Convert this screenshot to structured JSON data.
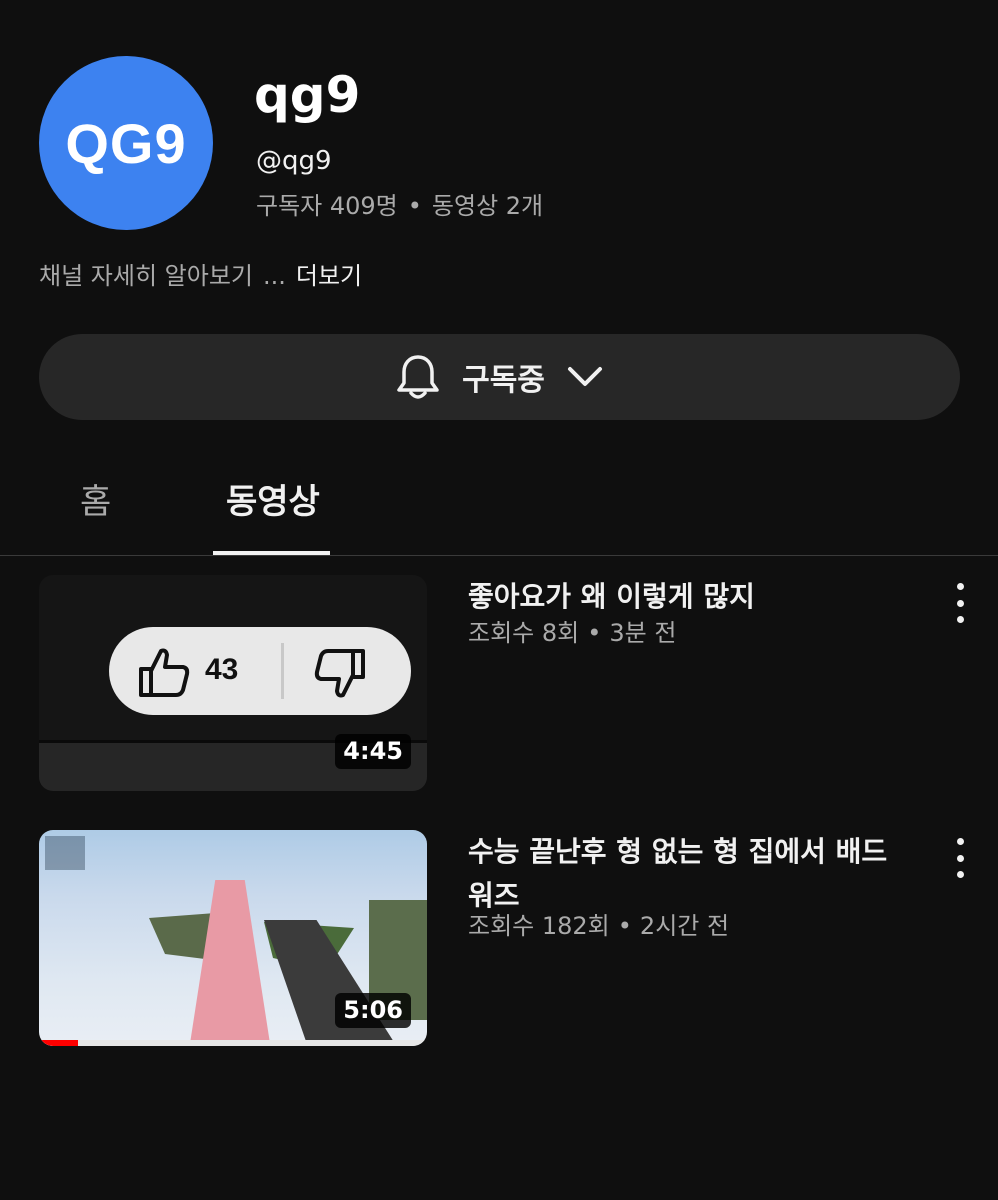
{
  "channel": {
    "avatar_text": "QG9",
    "name": "qg9",
    "handle": "@qg9",
    "subscribers": "구독자 409명",
    "video_count": "동영상 2개",
    "stats_separator": "•",
    "about": "채널 자세히 알아보기",
    "about_ellipsis": "...",
    "about_more": "더보기"
  },
  "subscribe_button": {
    "label": "구독중",
    "bell_icon": "bell-icon",
    "chevron_icon": "chevron-down-icon"
  },
  "tabs": [
    {
      "label": "홈",
      "selected": false
    },
    {
      "label": "동영상",
      "selected": true
    }
  ],
  "videos": [
    {
      "title": "좋아요가 왜 이렇게 많지",
      "views": "조회수 8회",
      "separator": "•",
      "age": "3분 전",
      "duration": "4:45",
      "thumbnail_like_count": "43"
    },
    {
      "title": "수능 끝난후 형 없는 형 집에서 배드워즈",
      "views": "조회수 182회",
      "separator": "•",
      "age": "2시간 전",
      "duration": "5:06",
      "watch_progress": 0.1
    }
  ],
  "colors": {
    "background": "#0f0f0f",
    "avatar": "#3d82f0",
    "pill": "#272727",
    "secondary_text": "#aaaaaa"
  }
}
